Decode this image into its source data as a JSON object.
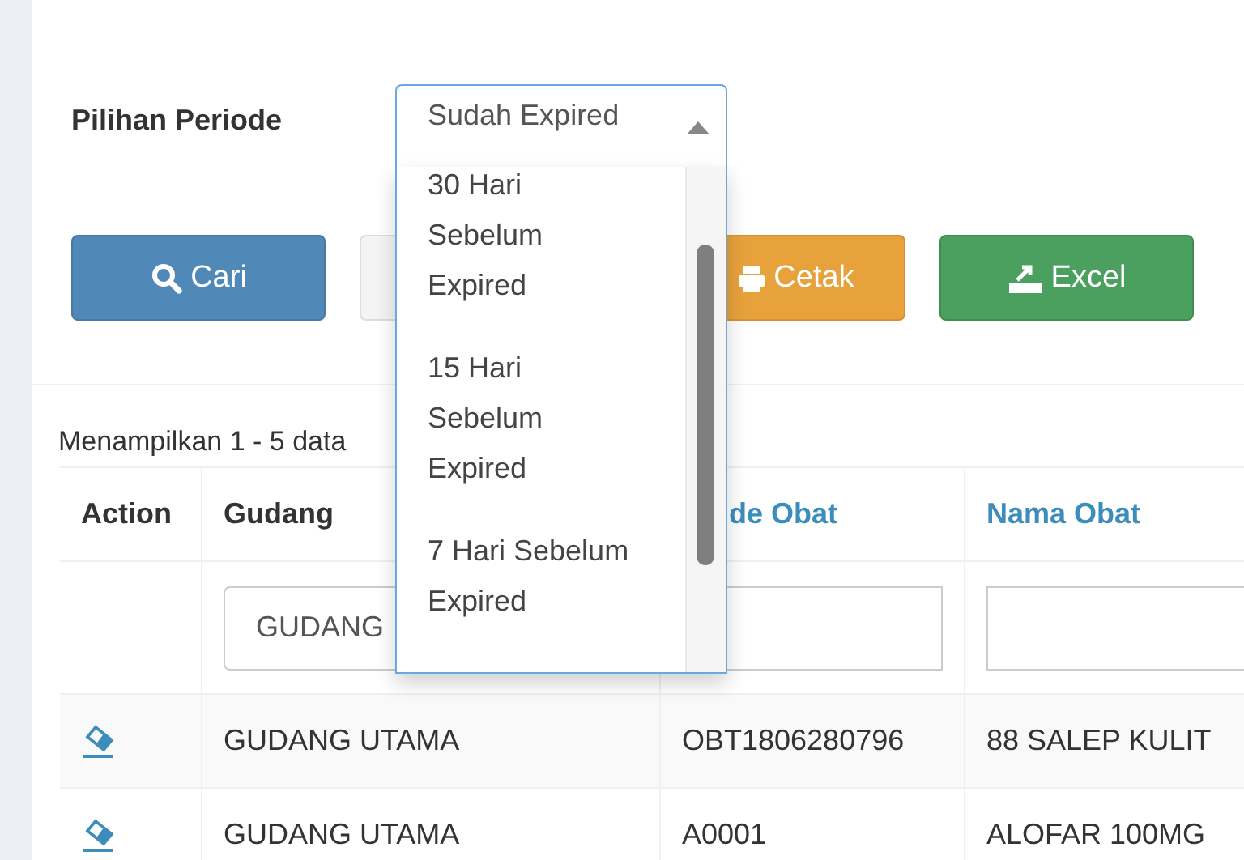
{
  "filter": {
    "label": "Pilihan Periode",
    "value": "Sudah Expired",
    "expanded": true,
    "options": [
      {
        "label": "30 Hari Sebelum Expired",
        "selected": false
      },
      {
        "label": "15 Hari Sebelum Expired",
        "selected": false
      },
      {
        "label": "7 Hari Sebelum Expired",
        "selected": false
      }
    ]
  },
  "buttons": [
    {
      "kind": "search",
      "label": "Cari"
    },
    {
      "kind": "plain"
    },
    {
      "kind": "print",
      "label": "Cetak"
    },
    {
      "kind": "excel",
      "label": "Excel"
    }
  ],
  "summary": "Menampilkan 1 - 5 data",
  "table": {
    "columns": [
      {
        "label": "Action",
        "link": false
      },
      {
        "label": "Gudang",
        "link": false
      },
      {
        "label": "de Obat",
        "link": true
      },
      {
        "label": "Nama Obat",
        "link": true
      }
    ],
    "filters": [
      {
        "kind": "none"
      },
      {
        "kind": "field",
        "value": "GUDANG"
      },
      {
        "kind": "field"
      },
      {
        "kind": "field"
      }
    ],
    "rows": [
      {
        "cells": [
          "",
          "GUDANG UTAMA",
          "OBT1806280796",
          "88 SALEP KULIT"
        ]
      },
      {
        "cells": [
          "",
          "GUDANG UTAMA",
          "A0001",
          "ALOFAR 100MG"
        ]
      }
    ]
  }
}
